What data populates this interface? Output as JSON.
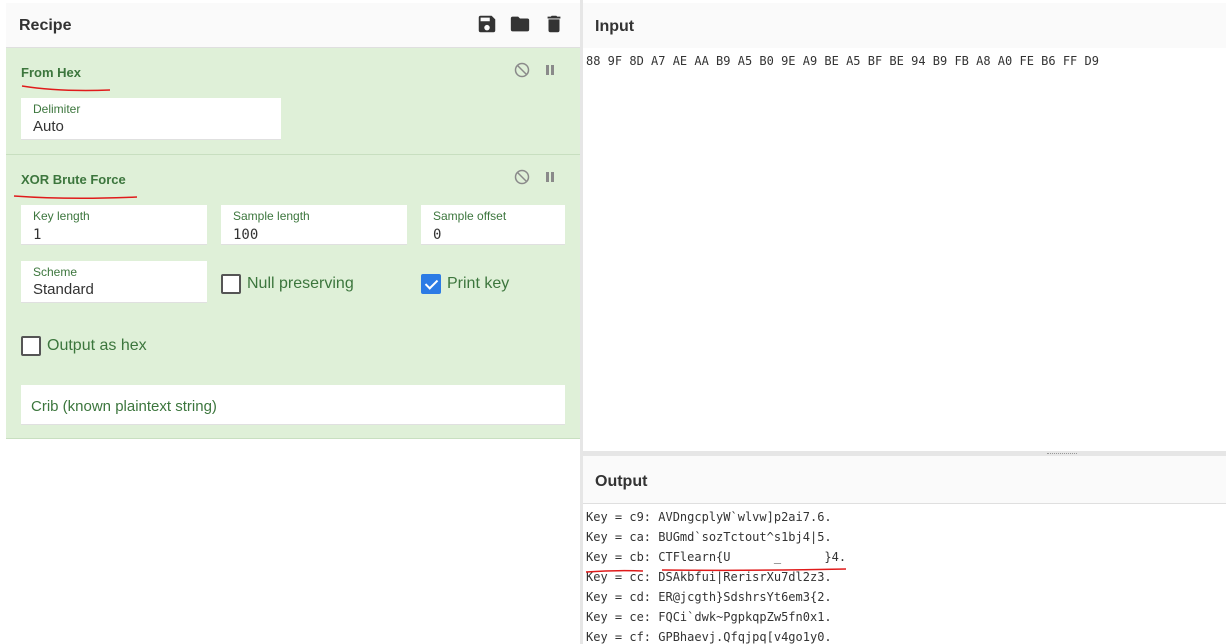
{
  "recipe": {
    "title": "Recipe",
    "icons": [
      "save-icon",
      "folder-icon",
      "trash-icon"
    ]
  },
  "operations": [
    {
      "title": "From Hex",
      "delimiter": {
        "label": "Delimiter",
        "value": "Auto"
      }
    },
    {
      "title": "XOR Brute Force",
      "key_length": {
        "label": "Key length",
        "value": "1"
      },
      "sample_length": {
        "label": "Sample length",
        "value": "100"
      },
      "sample_offset": {
        "label": "Sample offset",
        "value": "0"
      },
      "scheme": {
        "label": "Scheme",
        "value": "Standard"
      },
      "null_preserving": {
        "label": "Null preserving",
        "checked": false
      },
      "print_key": {
        "label": "Print key",
        "checked": true
      },
      "output_as_hex": {
        "label": "Output as hex",
        "checked": false
      },
      "crib": {
        "placeholder": "Crib (known plaintext string)"
      }
    }
  ],
  "input": {
    "title": "Input",
    "text": "88 9F 8D A7 AE AA B9 A5 B0 9E A9 BE A5 BF BE 94 B9 FB A8 A0 FE B6 FF D9"
  },
  "output": {
    "title": "Output",
    "lines": [
      "Key = c9: AVDngcplyW`wlvw]p2ai7.6.",
      "Key = ca: BUGmd`sozTctout^s1bj4|5.",
      "Key = cb: CTFlearn{U      _      }4.",
      "Key = cc: DSAkbfui|RerisrXu7dl2z3.",
      "Key = cd: ER@jcgth}SdshrsYt6em3{2.",
      "Key = ce: FQCi`dwk~PgpkqpZw5fn0x1.",
      "Key = cf: GPBhaevj.Qfqjpq[v4go1y0."
    ]
  },
  "colors": {
    "op_bg": "#dff0d8",
    "op_text": "#3c763d",
    "checkbox_on": "#2c7be5",
    "annotation": "#e01b1b"
  }
}
